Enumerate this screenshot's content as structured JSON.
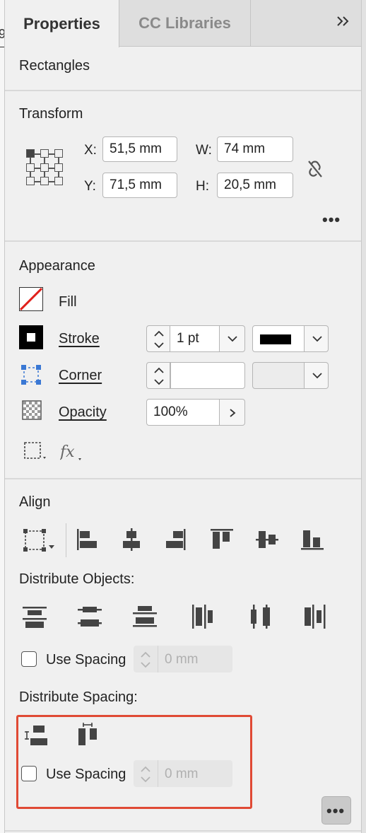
{
  "tabs": {
    "active": "Properties",
    "inactive": "CC Libraries",
    "more_glyph": "»"
  },
  "selection_label": "Rectangles",
  "transform": {
    "title": "Transform",
    "x_label": "X:",
    "x_value": "51,5 mm",
    "y_label": "Y:",
    "y_value": "71,5 mm",
    "w_label": "W:",
    "w_value": "74 mm",
    "h_label": "H:",
    "h_value": "20,5 mm",
    "more": "•••"
  },
  "appearance": {
    "title": "Appearance",
    "fill_label": "Fill",
    "stroke_label": "Stroke",
    "stroke_weight": "1 pt",
    "corner_label": "Corner",
    "corner_value": "",
    "opacity_label": "Opacity",
    "opacity_value": "100%",
    "fx_label": "fx"
  },
  "align": {
    "title": "Align",
    "distribute_objects_title": "Distribute Objects:",
    "use_spacing_label": "Use Spacing",
    "spacing_value": "0 mm",
    "distribute_spacing_title": "Distribute Spacing:",
    "use_spacing_label_2": "Use Spacing",
    "spacing_value_2": "0 mm",
    "more": "•••"
  },
  "colors": {
    "highlight": "#e04a35",
    "fill_none_slash": "#e0201b"
  },
  "icons": [
    "reference-point-icon",
    "constrain-proportions-icon",
    "fill-none-icon",
    "stroke-swatch-icon",
    "corner-icon",
    "opacity-icon",
    "frame-options-icon",
    "fx-icon",
    "align-to-selection-icon",
    "align-left-icon",
    "align-horizontal-center-icon",
    "align-right-icon",
    "align-top-icon",
    "align-vertical-center-icon",
    "align-bottom-icon",
    "distribute-top-icon",
    "distribute-vertical-center-icon",
    "distribute-bottom-icon",
    "distribute-left-icon",
    "distribute-horizontal-center-icon",
    "distribute-right-icon",
    "distribute-vertical-space-icon",
    "distribute-horizontal-space-icon"
  ]
}
